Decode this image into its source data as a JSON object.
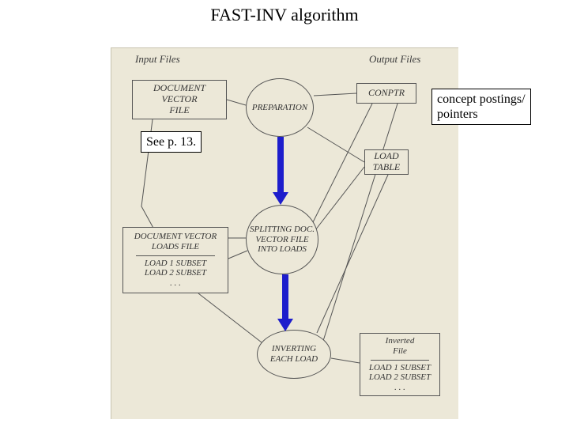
{
  "title": "FAST-INV algorithm",
  "headers": {
    "input": "Input Files",
    "output": "Output Files"
  },
  "boxes": {
    "docvec": {
      "line1": "DOCUMENT VECTOR",
      "line2": "FILE"
    },
    "conptr": "CONPTR",
    "loadtable": {
      "line1": "LOAD",
      "line2": "TABLE"
    },
    "dvloads": {
      "title": "DOCUMENT VECTOR LOADS FILE",
      "sub1": "LOAD 1 SUBSET",
      "sub2": "LOAD 2 SUBSET",
      "dots": ". . ."
    },
    "invfile": {
      "title1": "Inverted",
      "title2": "File",
      "sub1": "LOAD 1 SUBSET",
      "sub2": "LOAD 2 SUBSET",
      "dots": ". . ."
    }
  },
  "circles": {
    "prep": "PREPARATION",
    "split": "SPLITTING DOC. VECTOR FILE INTO LOADS",
    "invert": "INVERTING EACH LOAD"
  },
  "overlays": {
    "see": "See p. 13.",
    "concept_line1": "concept postings/",
    "concept_line2": "pointers"
  }
}
